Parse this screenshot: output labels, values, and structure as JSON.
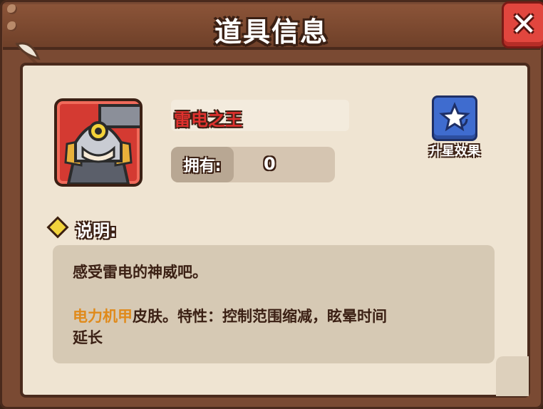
{
  "window": {
    "title": "道具信息",
    "close_label": "✕"
  },
  "item": {
    "name": "雷电之王",
    "own_label": "拥有:",
    "own_value": "0"
  },
  "upgrade": {
    "label": "升星效果"
  },
  "description": {
    "heading": "说明:",
    "line1": "感受雷电的神威吧。",
    "line2_highlight": "电力机甲",
    "line2_rest": "皮肤。特性：控制范围缩减，眩晕时间",
    "line3": "延长"
  },
  "colors": {
    "name_red": "#e0312e",
    "highlight_orange": "#e08a1a",
    "star_button": "#3f6ccf",
    "close_button": "#e1463e"
  }
}
